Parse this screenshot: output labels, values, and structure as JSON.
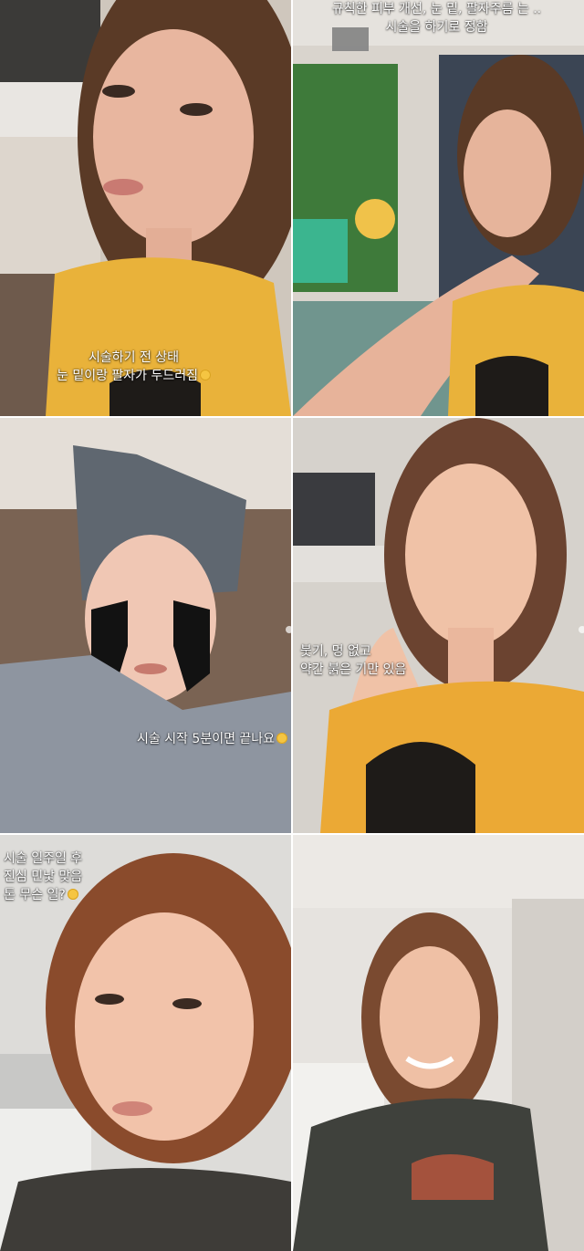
{
  "panels": [
    {
      "caption": {
        "lines": [
          "시술하기 전 상태",
          "눈 밑이랑 팔자가 두드러짐"
        ],
        "emoji": "crying-face-icon"
      }
    },
    {
      "caption": {
        "lines": [
          "규칙한 피부 개선, 눈 밑, 팔자주름 는 ..",
          "시술을 하기로 정함"
        ]
      }
    },
    {
      "caption": {
        "lines": [
          "시술 시작 5분이면 끝나요"
        ],
        "emoji": "smile-face-icon"
      }
    },
    {
      "caption": {
        "lines": [
          "붓기, 멍 없고",
          "약간 붉은 기만 있음"
        ]
      }
    },
    {
      "caption": {
        "lines": [
          "시술 일주일 후",
          "진심 민낯 맞음",
          "톤 무슨 일?"
        ],
        "emoji": "smile-face-icon"
      }
    },
    {
      "caption": {
        "lines": []
      }
    }
  ]
}
